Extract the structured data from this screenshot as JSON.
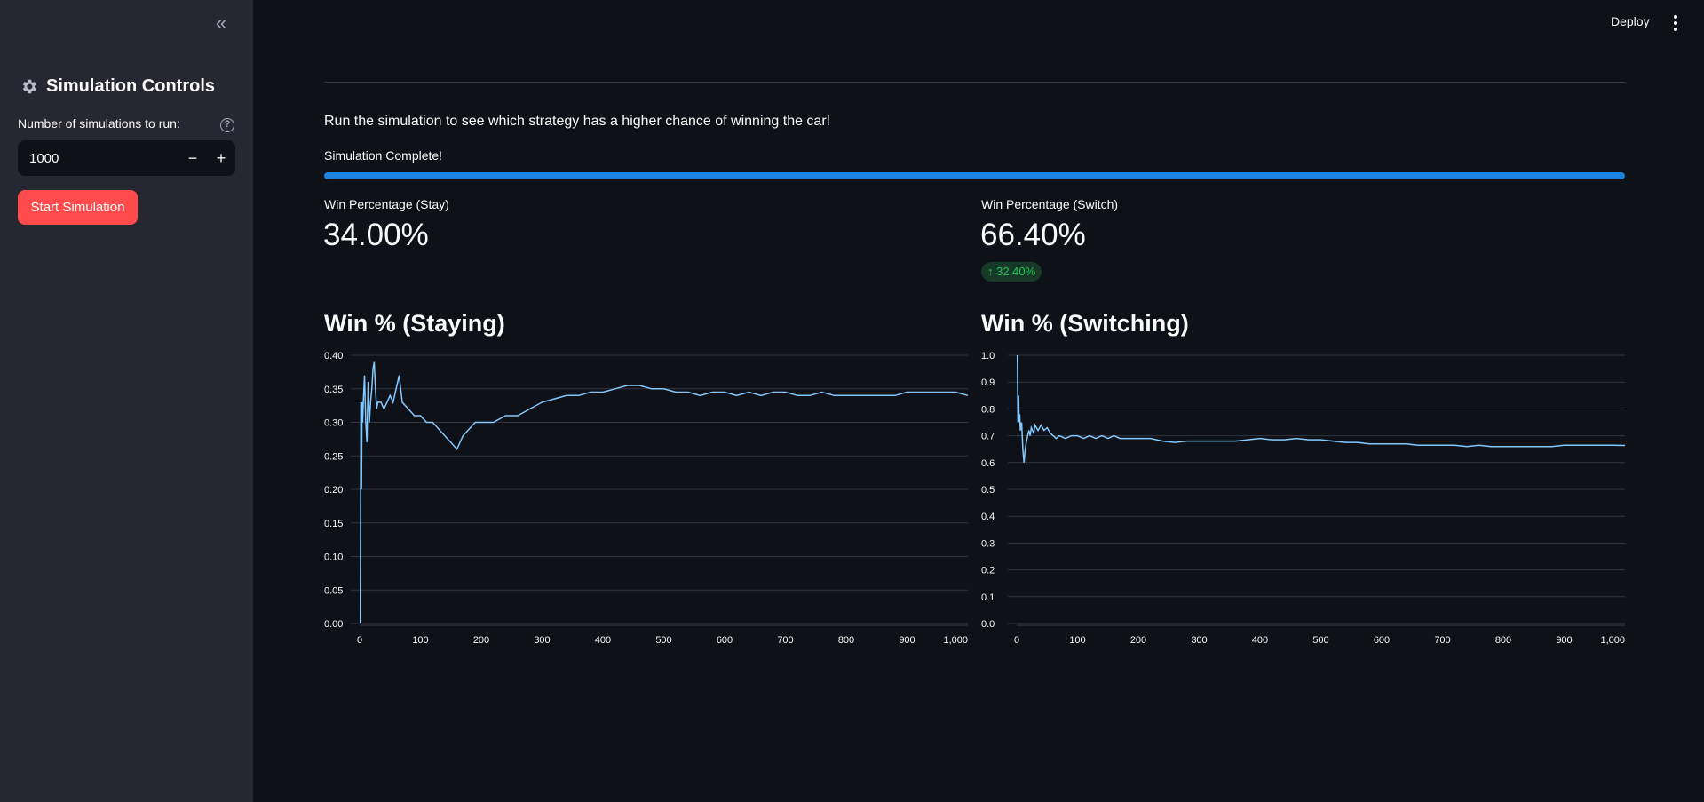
{
  "sidebar": {
    "collapse_icon": "chevrons-left-icon",
    "title": "Simulation Controls",
    "title_icon": "gear-icon",
    "input_label": "Number of simulations to run:",
    "input_value": "1000",
    "help_icon": "?",
    "decrement_label": "−",
    "increment_label": "+",
    "start_button": "Start Simulation"
  },
  "header": {
    "deploy": "Deploy"
  },
  "main": {
    "intro": "Run the simulation to see which strategy has a higher chance of winning the car!",
    "progress_label": "Simulation Complete!",
    "progress_value": 1.0,
    "metrics": [
      {
        "label": "Win Percentage (Stay)",
        "value": "34.00%"
      },
      {
        "label": "Win Percentage (Switch)",
        "value": "66.40%",
        "delta": "↑ 32.40%"
      }
    ]
  },
  "colors": {
    "accent": "#ff4b4b",
    "progress": "#1c83e1",
    "line": "#83c9ff",
    "delta_positive": "#21c354"
  },
  "chart_data": [
    {
      "type": "line",
      "title": "Win % (Staying)",
      "xlabel": "",
      "ylabel": "",
      "xlim": [
        0,
        1000
      ],
      "ylim": [
        0,
        0.4
      ],
      "xticks": [
        0,
        100,
        200,
        300,
        400,
        500,
        600,
        700,
        800,
        900,
        1000
      ],
      "xtick_labels": [
        "0",
        "100",
        "200",
        "300",
        "400",
        "500",
        "600",
        "700",
        "800",
        "900",
        "1,000"
      ],
      "yticks": [
        0,
        0.05,
        0.1,
        0.15,
        0.2,
        0.25,
        0.3,
        0.35,
        0.4
      ],
      "ytick_labels": [
        "0.00",
        "0.05",
        "0.10",
        "0.15",
        "0.20",
        "0.25",
        "0.30",
        "0.35",
        "0.40"
      ],
      "x": [
        1,
        2,
        3,
        4,
        5,
        6,
        8,
        10,
        12,
        14,
        16,
        18,
        20,
        22,
        24,
        26,
        28,
        30,
        35,
        40,
        45,
        50,
        55,
        60,
        65,
        70,
        80,
        90,
        100,
        110,
        120,
        130,
        140,
        150,
        160,
        170,
        180,
        190,
        200,
        220,
        240,
        260,
        280,
        300,
        320,
        340,
        360,
        380,
        400,
        420,
        440,
        460,
        480,
        500,
        520,
        540,
        560,
        580,
        600,
        620,
        640,
        660,
        680,
        700,
        720,
        740,
        760,
        780,
        800,
        820,
        840,
        860,
        880,
        900,
        920,
        940,
        960,
        980,
        1000
      ],
      "y": [
        0.0,
        0.33,
        0.2,
        0.33,
        0.3,
        0.33,
        0.37,
        0.3,
        0.27,
        0.36,
        0.3,
        0.33,
        0.35,
        0.38,
        0.39,
        0.35,
        0.32,
        0.33,
        0.33,
        0.32,
        0.33,
        0.34,
        0.33,
        0.35,
        0.37,
        0.33,
        0.32,
        0.31,
        0.31,
        0.3,
        0.3,
        0.29,
        0.28,
        0.27,
        0.26,
        0.28,
        0.29,
        0.3,
        0.3,
        0.3,
        0.31,
        0.31,
        0.32,
        0.33,
        0.335,
        0.34,
        0.34,
        0.345,
        0.345,
        0.35,
        0.355,
        0.355,
        0.35,
        0.35,
        0.345,
        0.345,
        0.34,
        0.345,
        0.345,
        0.34,
        0.345,
        0.34,
        0.345,
        0.345,
        0.34,
        0.34,
        0.345,
        0.34,
        0.34,
        0.34,
        0.34,
        0.34,
        0.34,
        0.345,
        0.345,
        0.345,
        0.345,
        0.345,
        0.34
      ]
    },
    {
      "type": "line",
      "title": "Win % (Switching)",
      "xlabel": "",
      "ylabel": "",
      "xlim": [
        0,
        1000
      ],
      "ylim": [
        0,
        1.0
      ],
      "xticks": [
        0,
        100,
        200,
        300,
        400,
        500,
        600,
        700,
        800,
        900,
        1000
      ],
      "xtick_labels": [
        "0",
        "100",
        "200",
        "300",
        "400",
        "500",
        "600",
        "700",
        "800",
        "900",
        "1,000"
      ],
      "yticks": [
        0,
        0.1,
        0.2,
        0.3,
        0.4,
        0.5,
        0.6,
        0.7,
        0.8,
        0.9,
        1.0
      ],
      "ytick_labels": [
        "0.0",
        "0.1",
        "0.2",
        "0.3",
        "0.4",
        "0.5",
        "0.6",
        "0.7",
        "0.8",
        "0.9",
        "1.0"
      ],
      "x": [
        1,
        2,
        3,
        4,
        5,
        6,
        8,
        10,
        12,
        14,
        16,
        18,
        20,
        22,
        24,
        26,
        28,
        30,
        35,
        40,
        45,
        50,
        55,
        60,
        65,
        70,
        80,
        90,
        100,
        110,
        120,
        130,
        140,
        150,
        160,
        170,
        180,
        190,
        200,
        220,
        240,
        260,
        280,
        300,
        320,
        340,
        360,
        380,
        400,
        420,
        440,
        460,
        480,
        500,
        520,
        540,
        560,
        580,
        600,
        620,
        640,
        660,
        680,
        700,
        720,
        740,
        760,
        780,
        800,
        820,
        840,
        860,
        880,
        900,
        920,
        940,
        960,
        980,
        1000
      ],
      "y": [
        1.0,
        0.75,
        0.85,
        0.75,
        0.78,
        0.72,
        0.75,
        0.65,
        0.6,
        0.65,
        0.68,
        0.7,
        0.72,
        0.7,
        0.73,
        0.72,
        0.71,
        0.74,
        0.72,
        0.74,
        0.72,
        0.73,
        0.71,
        0.7,
        0.69,
        0.7,
        0.69,
        0.7,
        0.7,
        0.69,
        0.7,
        0.69,
        0.7,
        0.69,
        0.7,
        0.69,
        0.69,
        0.69,
        0.69,
        0.69,
        0.68,
        0.675,
        0.68,
        0.68,
        0.68,
        0.68,
        0.68,
        0.685,
        0.69,
        0.685,
        0.685,
        0.69,
        0.685,
        0.685,
        0.68,
        0.675,
        0.675,
        0.67,
        0.67,
        0.67,
        0.67,
        0.665,
        0.665,
        0.665,
        0.665,
        0.66,
        0.665,
        0.66,
        0.66,
        0.66,
        0.66,
        0.66,
        0.66,
        0.665,
        0.665,
        0.665,
        0.665,
        0.665,
        0.664
      ]
    }
  ]
}
